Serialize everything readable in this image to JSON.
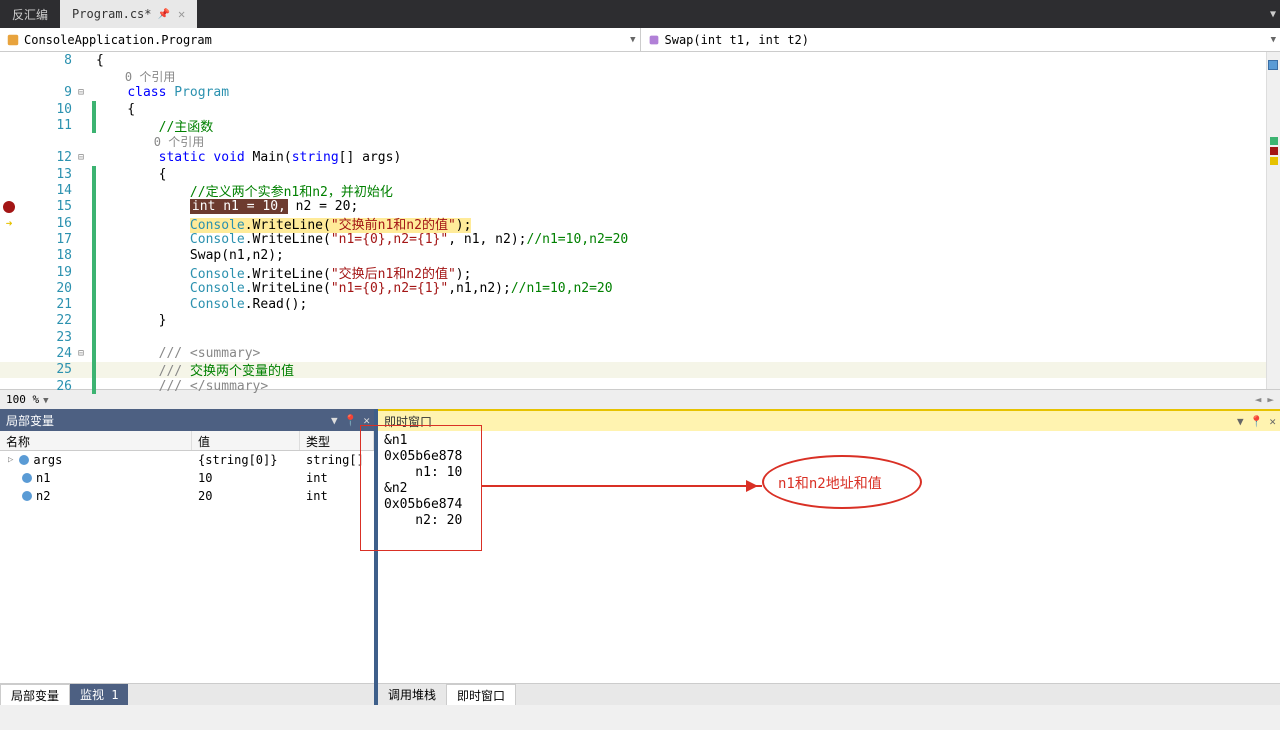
{
  "tabs": {
    "left": "反汇编",
    "active": "Program.cs*"
  },
  "nav": {
    "left": "ConsoleApplication.Program",
    "right": "Swap(int t1, int t2)"
  },
  "zoom": "100 %",
  "code": {
    "ref": "0 个引用",
    "l9": {
      "kw": "class",
      "name": " Program"
    },
    "l11_cmt": "//主函数",
    "l12": {
      "k1": "static",
      "k2": "void",
      "name": " Main(",
      "k3": "string",
      "rest": "[] args)"
    },
    "l14_cmt": "//定义两个实参n1和n2，并初始化",
    "l15": {
      "hl": "int n1 = 10,",
      "rest": " n2 = 20;"
    },
    "l16": {
      "c": "Console",
      "m": ".WriteLine(",
      "s": "\"交换前n1和n2的值\"",
      "e": ");"
    },
    "l17": {
      "c": "Console",
      "m": ".WriteLine(",
      "s": "\"n1={0},n2={1}\"",
      "r": ", n1, n2);",
      "cmt": "//n1=10,n2=20"
    },
    "l18": "Swap(n1,n2);",
    "l19": {
      "c": "Console",
      "m": ".WriteLine(",
      "s": "\"交换后n1和n2的值\"",
      "e": ");"
    },
    "l20": {
      "c": "Console",
      "m": ".WriteLine(",
      "s": "\"n1={0},n2={1}\"",
      "r": ",n1,n2);",
      "cmt": "//n1=10,n2=20"
    },
    "l21": {
      "c": "Console",
      "m": ".Read();"
    },
    "l24": "/// <summary>",
    "l25": {
      "p": "/// ",
      "t": "交换两个变量的值"
    },
    "l26": "/// </summary>"
  },
  "lines": {
    "n8": "8",
    "n9": "9",
    "n10": "10",
    "n11": "11",
    "n12": "12",
    "n13": "13",
    "n14": "14",
    "n15": "15",
    "n16": "16",
    "n17": "17",
    "n18": "18",
    "n19": "19",
    "n20": "20",
    "n21": "21",
    "n22": "22",
    "n23": "23",
    "n24": "24",
    "n25": "25",
    "n26": "26"
  },
  "locals": {
    "title": "局部变量",
    "cols": {
      "name": "名称",
      "value": "值",
      "type": "类型"
    },
    "rows": [
      {
        "name": "args",
        "value": "{string[0]}",
        "type": "string[]",
        "expandable": true
      },
      {
        "name": "n1",
        "value": "10",
        "type": "int",
        "expandable": false
      },
      {
        "name": "n2",
        "value": "20",
        "type": "int",
        "expandable": false
      }
    ]
  },
  "immediate": {
    "title": "即时窗口",
    "lines": [
      "&n1",
      "0x05b6e878",
      "    n1: 10",
      "&n2",
      "0x05b6e874",
      "    n2: 20"
    ]
  },
  "annotation": "n1和n2地址和值",
  "bottom_tabs": {
    "locals": "局部变量",
    "watch": "监视 1",
    "callstack": "调用堆栈",
    "immediate": "即时窗口"
  }
}
